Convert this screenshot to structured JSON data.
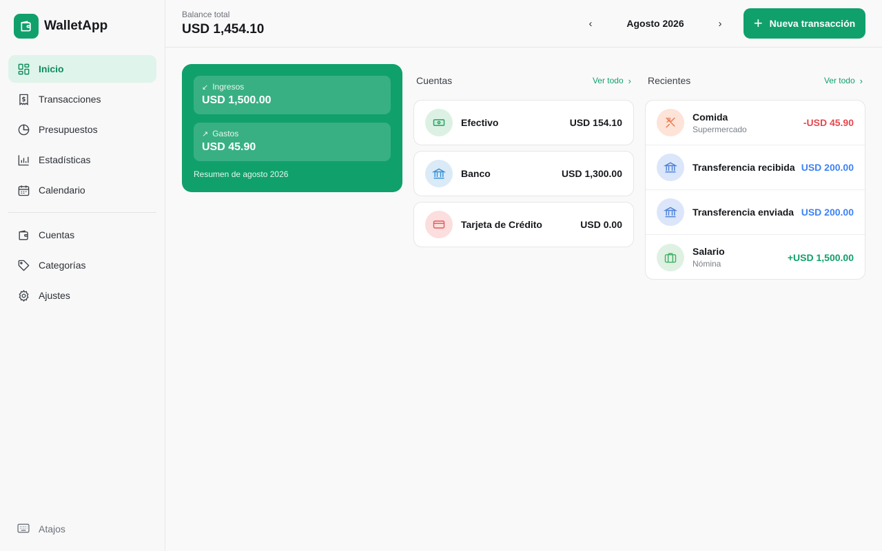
{
  "app": {
    "name": "WalletApp"
  },
  "colors": {
    "accent": "#10a06c",
    "negative": "#e5484d",
    "transfer": "#3b82f6",
    "positive": "#10a06c"
  },
  "sidebar": {
    "primary": [
      {
        "label": "Inicio",
        "icon": "grid-icon",
        "active": true
      },
      {
        "label": "Transacciones",
        "icon": "receipt-icon"
      },
      {
        "label": "Presupuestos",
        "icon": "pie-chart-icon"
      },
      {
        "label": "Estadísticas",
        "icon": "bar-chart-icon"
      },
      {
        "label": "Calendario",
        "icon": "calendar-icon"
      }
    ],
    "secondary": [
      {
        "label": "Cuentas",
        "icon": "wallet-icon"
      },
      {
        "label": "Categorías",
        "icon": "tag-icon"
      },
      {
        "label": "Ajustes",
        "icon": "gear-icon"
      }
    ],
    "footer": {
      "label": "Atajos",
      "icon": "keyboard-icon"
    }
  },
  "header": {
    "balance_label": "Balance total",
    "balance_value": "USD 1,454.10",
    "month_label": "Agosto 2026",
    "prev_symbol": "‹",
    "next_symbol": "›",
    "new_button_label": "Nueva transacción"
  },
  "summary": {
    "income_label": "Ingresos",
    "income_value": "USD 1,500.00",
    "expense_label": "Gastos",
    "expense_value": "USD 45.90",
    "caption": "Resumen de agosto 2026"
  },
  "accounts": {
    "title": "Cuentas",
    "view_all": "Ver todo",
    "items": [
      {
        "name": "Efectivo",
        "amount": "USD 154.10",
        "icon": "cash-icon"
      },
      {
        "name": "Banco",
        "amount": "USD 1,300.00",
        "icon": "bank-icon"
      },
      {
        "name": "Tarjeta de Crédito",
        "amount": "USD 0.00",
        "icon": "credit-card-icon"
      }
    ]
  },
  "recent": {
    "title": "Recientes",
    "view_all": "Ver todo",
    "items": [
      {
        "name": "Comida",
        "sub": "Supermercado",
        "amount": "-USD 45.90",
        "icon": "utensils-icon"
      },
      {
        "name": "Transferencia recibida",
        "sub": "",
        "amount": "USD 200.00",
        "icon": "bank-icon"
      },
      {
        "name": "Transferencia enviada",
        "sub": "",
        "amount": "USD 200.00",
        "icon": "bank-icon"
      },
      {
        "name": "Salario",
        "sub": "Nómina",
        "amount": "+USD 1,500.00",
        "icon": "briefcase-icon"
      }
    ]
  }
}
